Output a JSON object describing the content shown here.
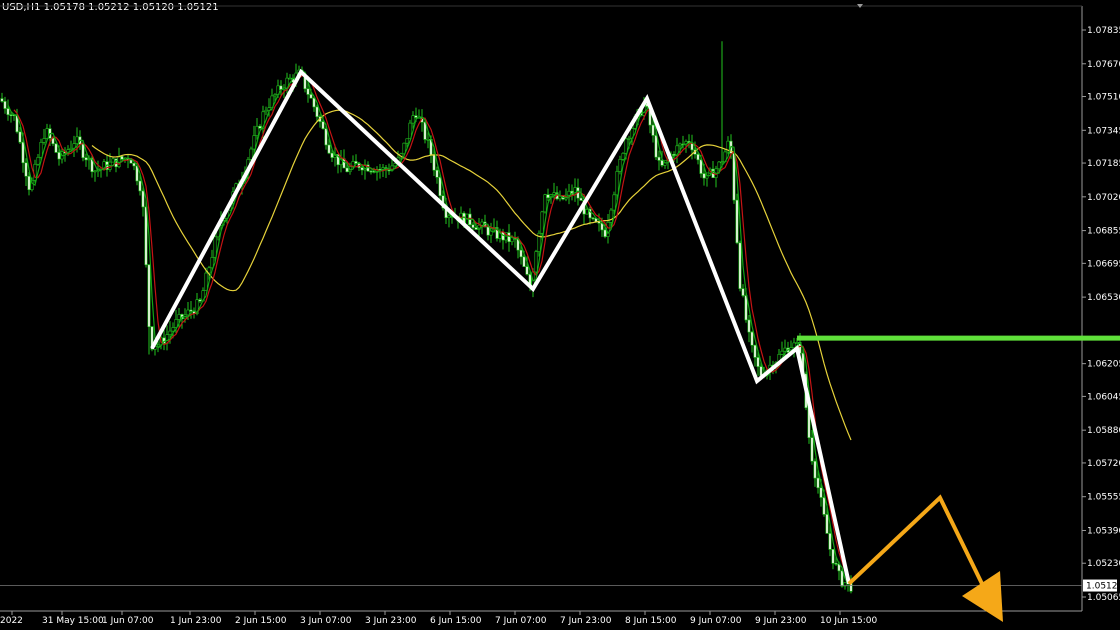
{
  "header": {
    "symbol": "USD,H1",
    "ohlc": "1.05178 1.05212 1.05120 1.05121"
  },
  "chart_data": {
    "type": "candlestick",
    "y_ticks": [
      "1.07835",
      "1.07670",
      "1.07510",
      "1.07345",
      "1.07185",
      "1.07020",
      "1.06855",
      "1.06695",
      "1.06530",
      "1.06205",
      "1.06045",
      "1.05880",
      "1.05720",
      "1.05555",
      "1.05390",
      "1.05230",
      "1.05065"
    ],
    "ylim": [
      1.04945,
      1.07985
    ],
    "x_ticks": [
      "2022",
      "31 May 15:00",
      "1 Jun 07:00",
      "1 Jun 23:00",
      "2 Jun 15:00",
      "3 Jun 07:00",
      "3 Jun 23:00",
      "6 Jun 15:00",
      "7 Jun 07:00",
      "7 Jun 23:00",
      "8 Jun 15:00",
      "9 Jun 07:00",
      "9 Jun 23:00",
      "10 Jun 15:00"
    ],
    "current_price": "1.05121",
    "horizontal_level": 1.0633,
    "colors": {
      "background": "#000000",
      "candle": "#22c31e",
      "fast_ma": "#14a514",
      "mid_ma": "#c41414",
      "slow_ma": "#e6d23a",
      "zigzag": "#ffffff",
      "level_line": "#5fe03a",
      "projection": "#f5a818",
      "axis": "#9a9a9a"
    },
    "zigzag": [
      {
        "x": "1 Jun 07:00",
        "y": 1.0628
      },
      {
        "x": "3 Jun 07:00",
        "y": 1.0763
      },
      {
        "x": "7 Jun 07:00",
        "y": 1.0657
      },
      {
        "x": "8 Jun 15:00",
        "y": 1.075
      },
      {
        "x": "9 Jun 23:00",
        "y": 1.0612
      },
      {
        "x": "9 Jun 23:00",
        "y": 1.0628
      },
      {
        "x": "10 Jun 15:00",
        "y": 1.0513
      }
    ],
    "projection": [
      {
        "x": "10 Jun 15:00",
        "y": 1.0513
      },
      {
        "y": 1.0555
      },
      {
        "y": 1.0505
      }
    ]
  }
}
